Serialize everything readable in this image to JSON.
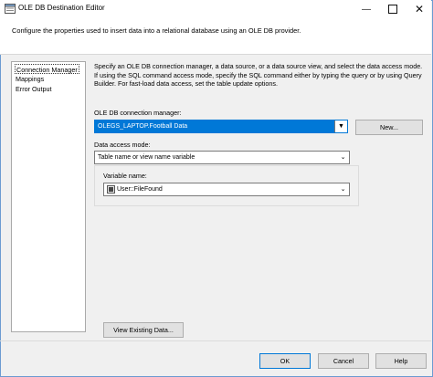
{
  "window": {
    "title": "OLE DB Destination Editor",
    "controls": [
      "minimize-icon",
      "maximize-icon",
      "close-icon"
    ]
  },
  "header": {
    "text": "Configure the properties used to insert data into a relational database using an OLE DB provider."
  },
  "nav": {
    "items": [
      {
        "label": "Connection Manager",
        "selected": true
      },
      {
        "label": "Mappings",
        "selected": false
      },
      {
        "label": "Error Output",
        "selected": false
      }
    ]
  },
  "main": {
    "description": "Specify an OLE DB connection manager, a data source, or a data source view, and select the data access mode. If using the SQL command access mode, specify the SQL command either by typing the query or by using Query Builder. For fast-load data access, set the table update options.",
    "connection_label": "OLE DB connection manager:",
    "connection_value": "OLEGS_LAPTOP.Football Data",
    "new_button": "New...",
    "access_mode_label": "Data access mode:",
    "access_mode_value": "Table name or view name variable",
    "variable_label": "Variable name:",
    "variable_value": "User::FileFound",
    "view_data_button": "View Existing Data..."
  },
  "footer": {
    "ok": "OK",
    "cancel": "Cancel",
    "help": "Help"
  },
  "colors": {
    "accent": "#0078d7",
    "frame": "#6b9bd1"
  }
}
